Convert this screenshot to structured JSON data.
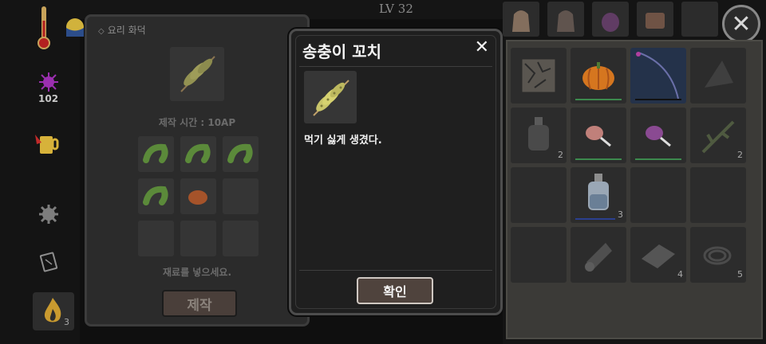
{
  "hud": {
    "level": "LV 32",
    "ap_value": "102",
    "fire_count": "3"
  },
  "craft_panel": {
    "title": "요리 화덕",
    "time_label": "제작 시간 : 10AP",
    "hint": "재료를 넣으세요.",
    "button": "제작"
  },
  "modal": {
    "title": "송충이 꼬치",
    "close": "✕",
    "description": "먹기 싫게 생겼다.",
    "confirm": "확인"
  },
  "inventory": {
    "close": "✕",
    "slots": [
      {
        "icon": "map-icon",
        "count": ""
      },
      {
        "icon": "pumpkin-icon",
        "count": ""
      },
      {
        "icon": "fishing-rod-icon",
        "count": ""
      },
      {
        "icon": "cloth-icon",
        "count": ""
      },
      {
        "icon": "empty-bottle-icon",
        "count": "2"
      },
      {
        "icon": "meat-icon",
        "count": ""
      },
      {
        "icon": "purple-meat-icon",
        "count": ""
      },
      {
        "icon": "branch-icon",
        "count": "2"
      },
      {
        "icon": "",
        "count": ""
      },
      {
        "icon": "water-bottle-icon",
        "count": "3"
      },
      {
        "icon": "",
        "count": ""
      },
      {
        "icon": "",
        "count": ""
      },
      {
        "icon": "",
        "count": ""
      },
      {
        "icon": "cloth-roll-icon",
        "count": ""
      },
      {
        "icon": "cloth-scrap-icon",
        "count": "4"
      },
      {
        "icon": "rope-icon",
        "count": "5"
      }
    ]
  },
  "colors": {
    "durability_green": "#3c8a4e",
    "durability_blue": "#2b3f8f"
  }
}
